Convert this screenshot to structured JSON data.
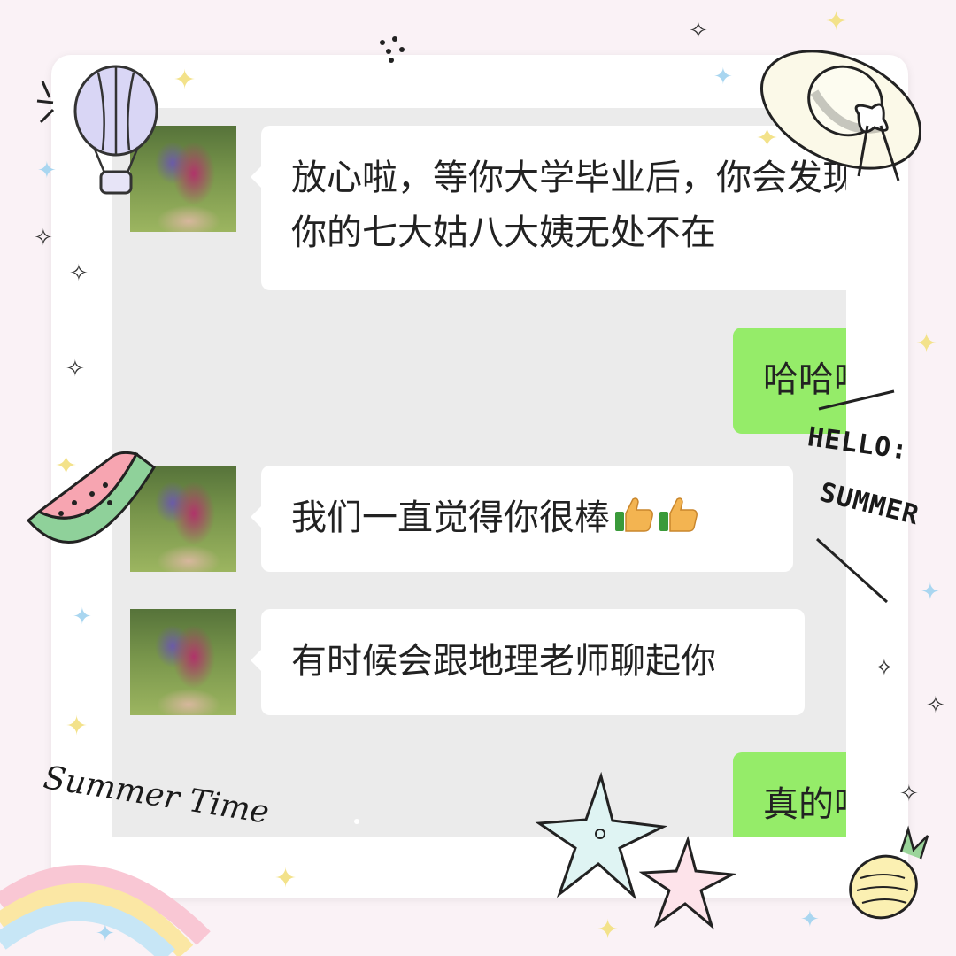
{
  "messages": [
    {
      "side": "left",
      "lines": [
        "放心啦，等你大学毕业后，你会发现",
        "你的七大姑八大姨无处不在"
      ]
    },
    {
      "side": "right",
      "text": "哈哈哈"
    },
    {
      "side": "left",
      "text": "我们一直觉得你很棒",
      "emoji": [
        "thumbs-up-icon",
        "thumbs-up-icon"
      ]
    },
    {
      "side": "left",
      "text": "有时候会跟地理老师聊起你"
    },
    {
      "side": "right",
      "text": "真的吗"
    }
  ],
  "decorations": {
    "hello": "HELLO:",
    "summer": "SUMMER",
    "summer_time": "Summer Time"
  },
  "colors": {
    "background": "#faf2f6",
    "chat_background": "#ebebeb",
    "incoming_bubble": "#ffffff",
    "outgoing_bubble": "#95ec69"
  }
}
